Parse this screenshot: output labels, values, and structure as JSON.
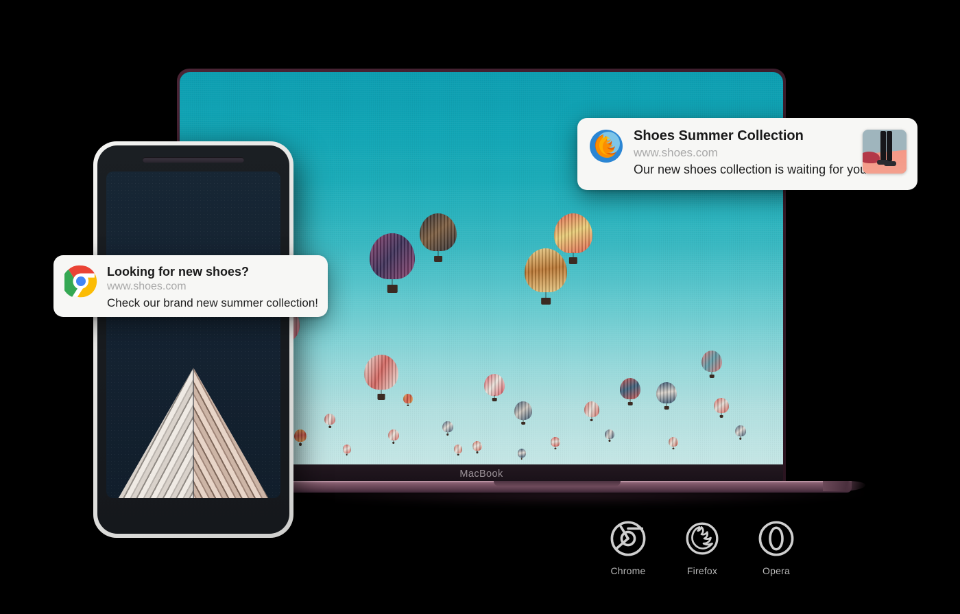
{
  "laptop": {
    "model_label": "MacBook",
    "wallpaper_name": "hot-air-balloons-teal-sky"
  },
  "phone": {
    "wallpaper_name": "building-roof-architecture"
  },
  "notifications": [
    {
      "id": "chrome",
      "browser": "Chrome",
      "icon": "chrome-icon",
      "title": "Looking for new shoes?",
      "url": "www.shoes.com",
      "body": "Check our brand new summer collection!",
      "has_thumbnail": false
    },
    {
      "id": "firefox",
      "browser": "Firefox",
      "icon": "firefox-icon",
      "title": "Shoes Summer Collection",
      "url": "www.shoes.com",
      "body": "Our new shoes collection is waiting for you!",
      "has_thumbnail": true,
      "thumbnail_alt": "shoes-photo"
    }
  ],
  "browsers": [
    {
      "name": "Chrome",
      "icon": "chrome-icon"
    },
    {
      "name": "Firefox",
      "icon": "firefox-icon"
    },
    {
      "name": "Opera",
      "icon": "opera-icon"
    }
  ],
  "colors": {
    "background": "#000000",
    "sky_top": "#0d9eb1",
    "sky_bottom": "#c6e7e6",
    "laptop_body": "#3a1c2a",
    "laptop_base": "#7d5768",
    "notification_bg": "#f7f7f5",
    "notification_url_text": "#a8a8a8",
    "browser_icon": "#cfcfcf"
  }
}
